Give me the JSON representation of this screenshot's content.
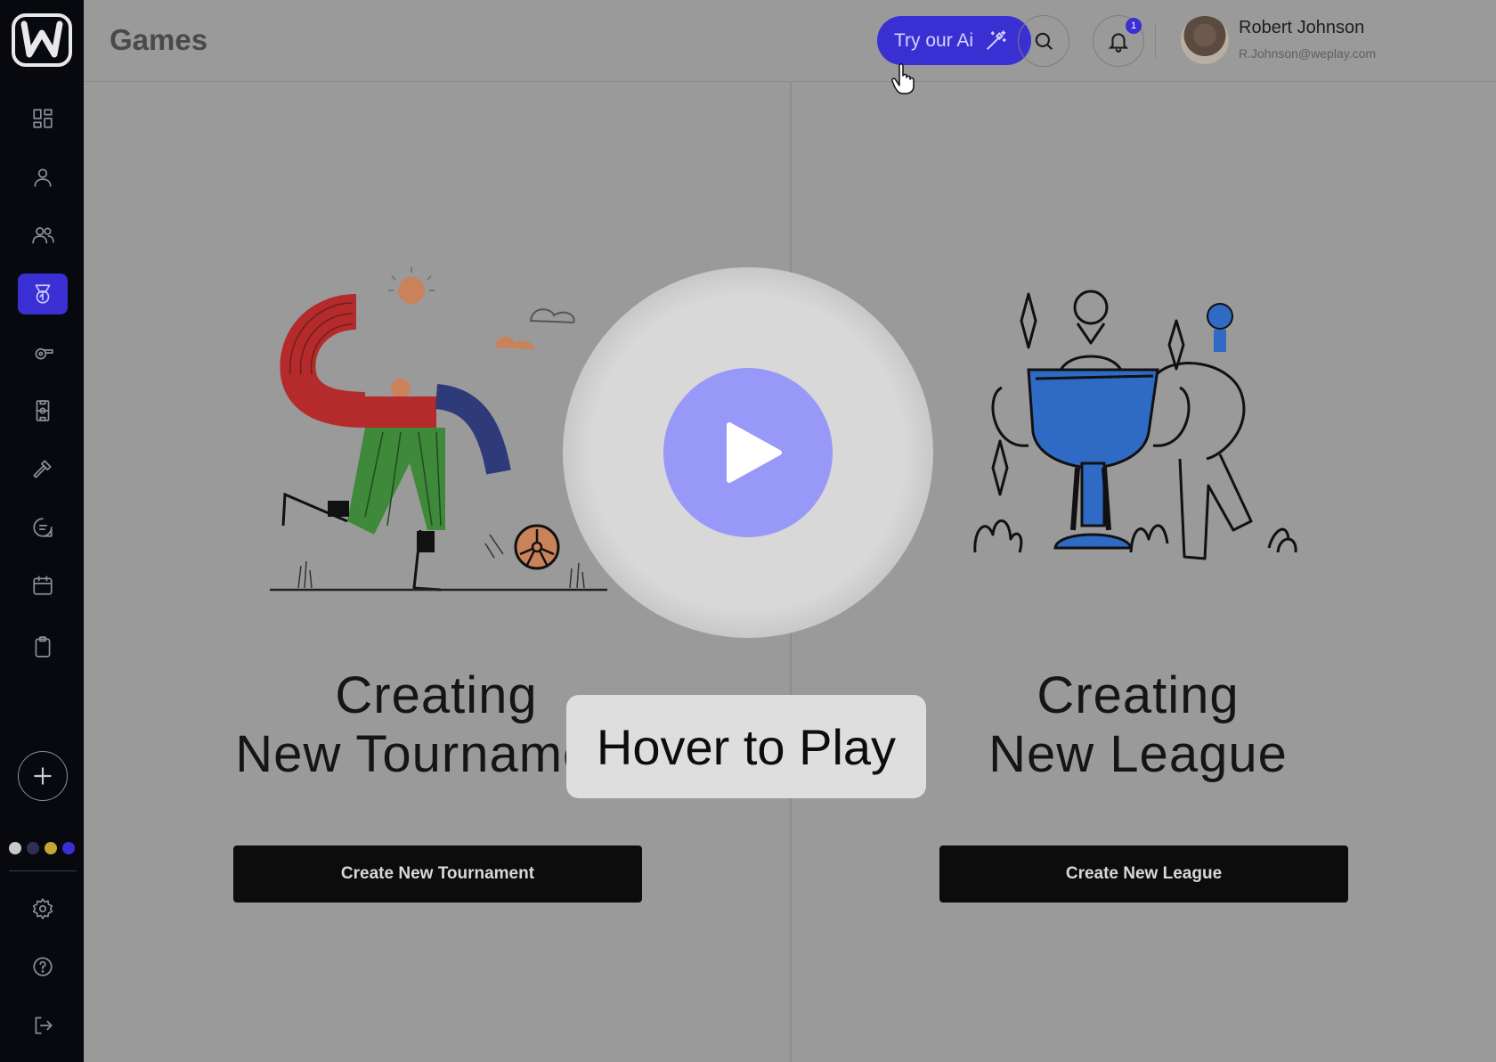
{
  "app": {
    "logo_letter": "W"
  },
  "header": {
    "title": "Games",
    "ai_button": "Try our Ai",
    "notification_count": "1",
    "user": {
      "name": "Robert Johnson",
      "email": "R.Johnson@weplay.com"
    }
  },
  "sidebar": {
    "items": [
      {
        "icon": "dashboard-icon"
      },
      {
        "icon": "user-icon"
      },
      {
        "icon": "users-icon"
      },
      {
        "icon": "medal-icon",
        "active": true
      },
      {
        "icon": "whistle-icon"
      },
      {
        "icon": "field-icon"
      },
      {
        "icon": "hammer-icon"
      },
      {
        "icon": "chat-icon"
      },
      {
        "icon": "calendar-icon"
      },
      {
        "icon": "clipboard-icon"
      }
    ],
    "bottom_items": [
      {
        "icon": "gear-icon"
      },
      {
        "icon": "help-icon"
      },
      {
        "icon": "logout-icon"
      }
    ],
    "theme_colors": [
      "#c9c9c9",
      "#2e3152",
      "#c2a832",
      "#3a2fd3"
    ]
  },
  "panels": {
    "tournament": {
      "heading_line1": "Creating",
      "heading_line2": "New Tournament",
      "button": "Create New Tournament"
    },
    "league": {
      "heading_line1": "Creating",
      "heading_line2": "New League",
      "button": "Create New League"
    }
  },
  "overlay": {
    "label": "Hover to Play"
  },
  "colors": {
    "accent": "#3a2fd3",
    "sidebar": "#08090f",
    "play": "#9898f8"
  }
}
